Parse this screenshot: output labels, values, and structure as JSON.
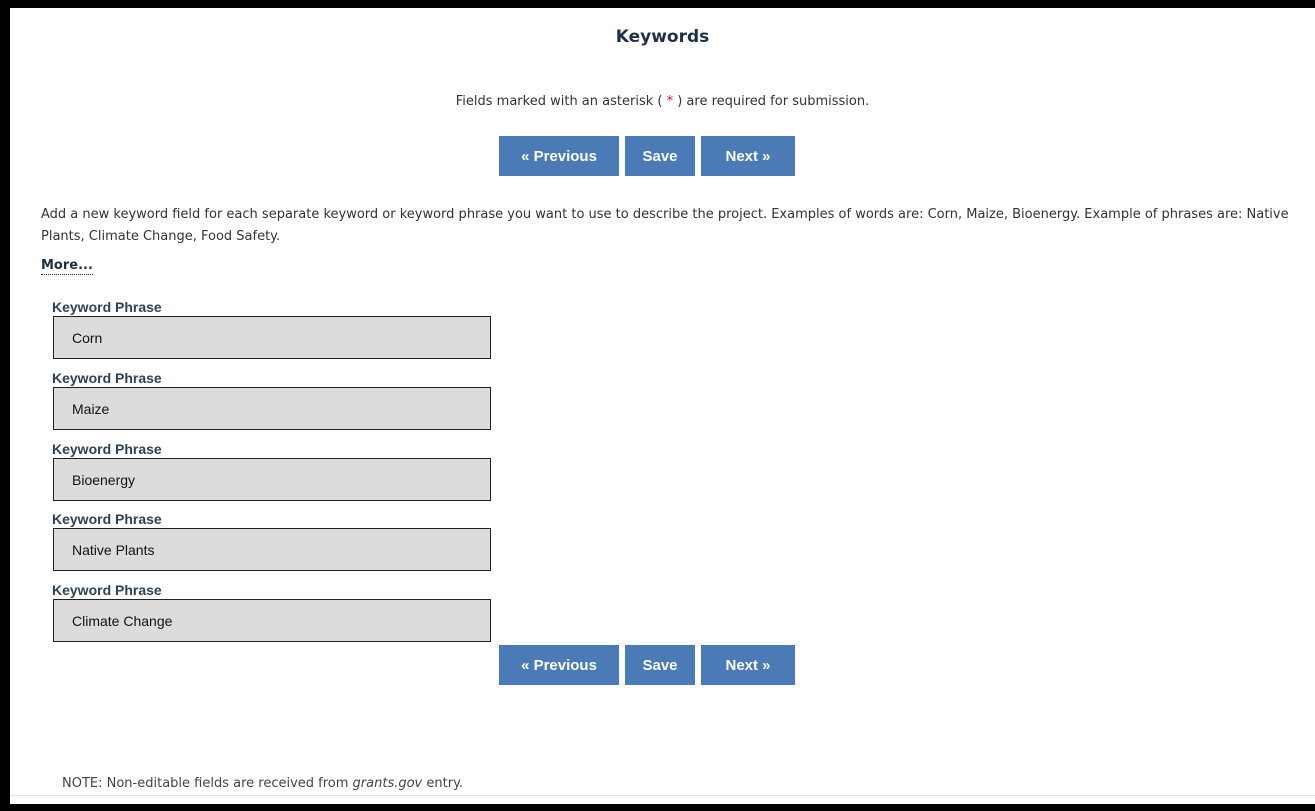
{
  "page": {
    "title": "Keywords",
    "required_note": {
      "before": "Fields marked with an asterisk (",
      "asterisk": " * ",
      "after": ") are required for submission."
    }
  },
  "nav_buttons": {
    "previous_label": "« Previous",
    "save_label": "Save",
    "next_label": "Next »"
  },
  "instructions": {
    "text": "Add a new keyword field for each separate keyword or keyword phrase you want to use to describe the project. Examples of words are: Corn, Maize, Bioenergy.  Example of phrases are: Native Plants, Climate Change, Food Safety.",
    "more_link": "More..."
  },
  "keywords": [
    {
      "label": "Keyword Phrase",
      "value": "Corn"
    },
    {
      "label": "Keyword Phrase",
      "value": "Maize"
    },
    {
      "label": "Keyword Phrase",
      "value": "Bioenergy"
    },
    {
      "label": "Keyword Phrase",
      "value": "Native Plants"
    },
    {
      "label": "Keyword Phrase",
      "value": "Climate Change"
    }
  ],
  "footer_note": {
    "prefix": "NOTE:",
    "text_before": " Non-editable fields are received from ",
    "source": "grants.gov",
    "text_after": " entry."
  },
  "colors": {
    "button_bg": "#4a7bb7",
    "asterisk": "#d21414",
    "field_bg": "#dcdcdc"
  }
}
